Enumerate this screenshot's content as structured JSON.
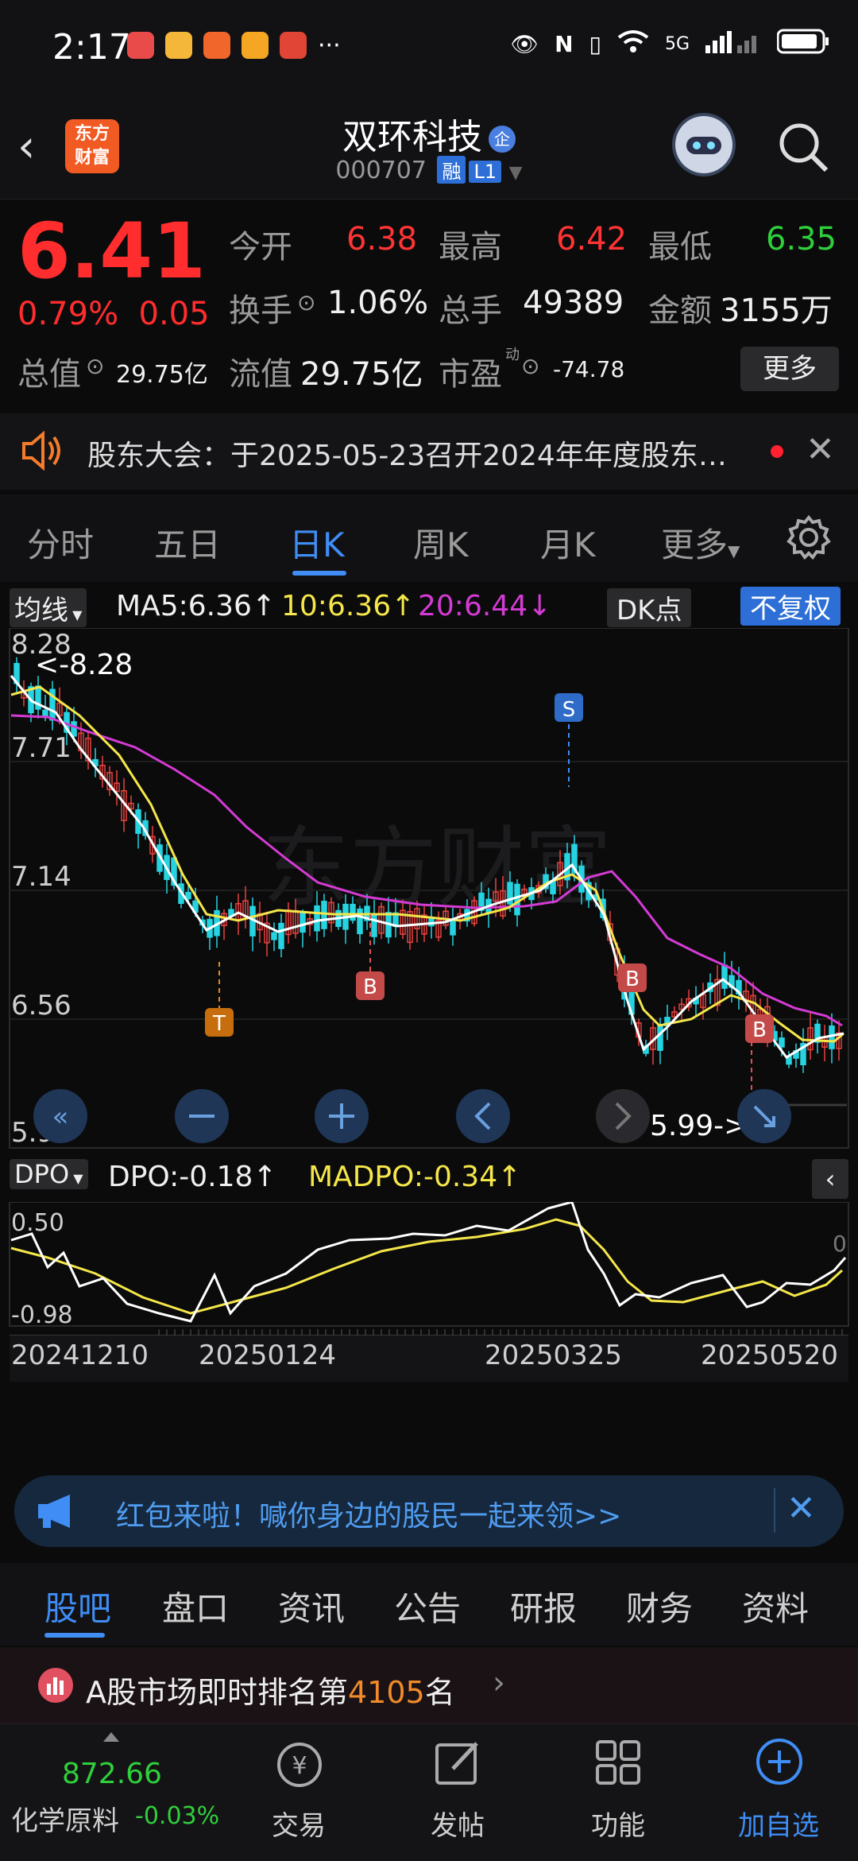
{
  "status_bar": {
    "time": "2:17",
    "signal": "5G",
    "dots": "···"
  },
  "header": {
    "logo_line1": "东方",
    "logo_line2": "财富",
    "stock_name": "双环科技",
    "badge": "企",
    "code": "000707",
    "tag_margin": "融",
    "tag_level": "L1"
  },
  "quote": {
    "price": "6.41",
    "change_pct": "0.79%",
    "change_val": "0.05",
    "open_label": "今开",
    "open": "6.38",
    "high_label": "最高",
    "high": "6.42",
    "low_label": "最低",
    "low": "6.35",
    "turnover_label": "换手",
    "turnover": "1.06%",
    "volume_label": "总手",
    "volume": "49389",
    "amount_label": "金额",
    "amount": "3155万",
    "mcap_label": "总值",
    "mcap": "29.75亿",
    "float_label": "流值",
    "float": "29.75亿",
    "pe_label": "市盈",
    "pe_sup": "动",
    "pe": "-74.78",
    "more": "更多"
  },
  "notice": {
    "text": "股东大会：于2025-05-23召开2024年年度股东…"
  },
  "tabs": [
    "分时",
    "五日",
    "日K",
    "周K",
    "月K",
    "更多"
  ],
  "ma_bar": {
    "selector": "均线",
    "ma5": "MA5:6.36↑",
    "ma10": "10:6.36↑",
    "ma20": "20:6.44↓",
    "dk": "DK点",
    "fq": "不复权"
  },
  "chart_data": {
    "type": "candlestick",
    "y_ticks": [
      "8.28",
      "7.71",
      "7.14",
      "6.56",
      "5.99"
    ],
    "ylim": [
      5.99,
      8.28
    ],
    "max_label": "<-8.28",
    "min_label": "5.99->",
    "signals": [
      "S",
      "T",
      "B",
      "B",
      "B"
    ],
    "x_ticks": [
      "20241210",
      "20250124",
      "20250325",
      "20250520"
    ],
    "watermark": "东方财富"
  },
  "dpo": {
    "selector": "DPO",
    "dpo": "DPO:-0.18↑",
    "madpo": "MADPO:-0.34↑",
    "y_top": "0.50",
    "y_bottom": "-0.98",
    "zero": "0"
  },
  "banner": {
    "text": "红包来啦！喊你身边的股民一起来领>>"
  },
  "bottom_tabs": [
    "股吧",
    "盘口",
    "资讯",
    "公告",
    "研报",
    "财务",
    "资料"
  ],
  "rank": {
    "prefix": "A股市场即时排名第",
    "num": "4105",
    "suffix": "名"
  },
  "bottom_nav": {
    "sector_value": "872.66",
    "sector_name": "化学原料",
    "sector_chg": "-0.03%",
    "trade": "交易",
    "post": "发帖",
    "func": "功能",
    "add": "加自选"
  }
}
